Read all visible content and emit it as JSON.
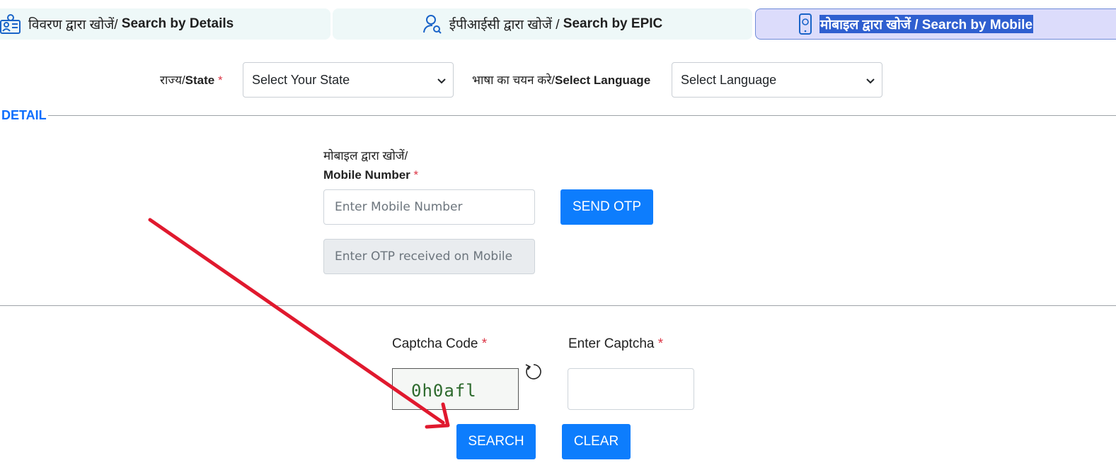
{
  "tabs": [
    {
      "hindi": "विवरण द्वारा खोजें/",
      "english": "Search by Details",
      "icon": "id-card-icon"
    },
    {
      "hindi": "ईपीआईसी द्वारा खोजें /",
      "english": "Search by EPIC",
      "icon": "user-search-icon"
    },
    {
      "text": "मोबाइल द्वारा खोजें / Search by Mobile",
      "icon": "mobile-phone-icon",
      "active": true
    }
  ],
  "state": {
    "label_hi": "राज्य/",
    "label_en": "State",
    "required": "*",
    "selected": "Select Your State"
  },
  "language": {
    "label_hi": "भाषा का चयन करे/",
    "label_en": "Select Language",
    "selected": "Select Language"
  },
  "detail": {
    "legend": "DETAIL"
  },
  "mobile": {
    "label_hi": "मोबाइल द्वारा खोजें/",
    "label_en": "Mobile Number",
    "required": "*",
    "placeholder": "Enter Mobile Number",
    "send_otp": "SEND OTP",
    "otp_placeholder": "Enter OTP received on Mobile"
  },
  "captcha": {
    "code_label": "Captcha Code",
    "enter_label": "Enter Captcha",
    "required": "*",
    "code": "0h0afl"
  },
  "buttons": {
    "search": "SEARCH",
    "clear": "CLEAR"
  },
  "colors": {
    "accent": "#0d7dfd",
    "required": "#dc3545",
    "legend": "#0d6efd",
    "annotation_arrow": "#e0192e"
  }
}
